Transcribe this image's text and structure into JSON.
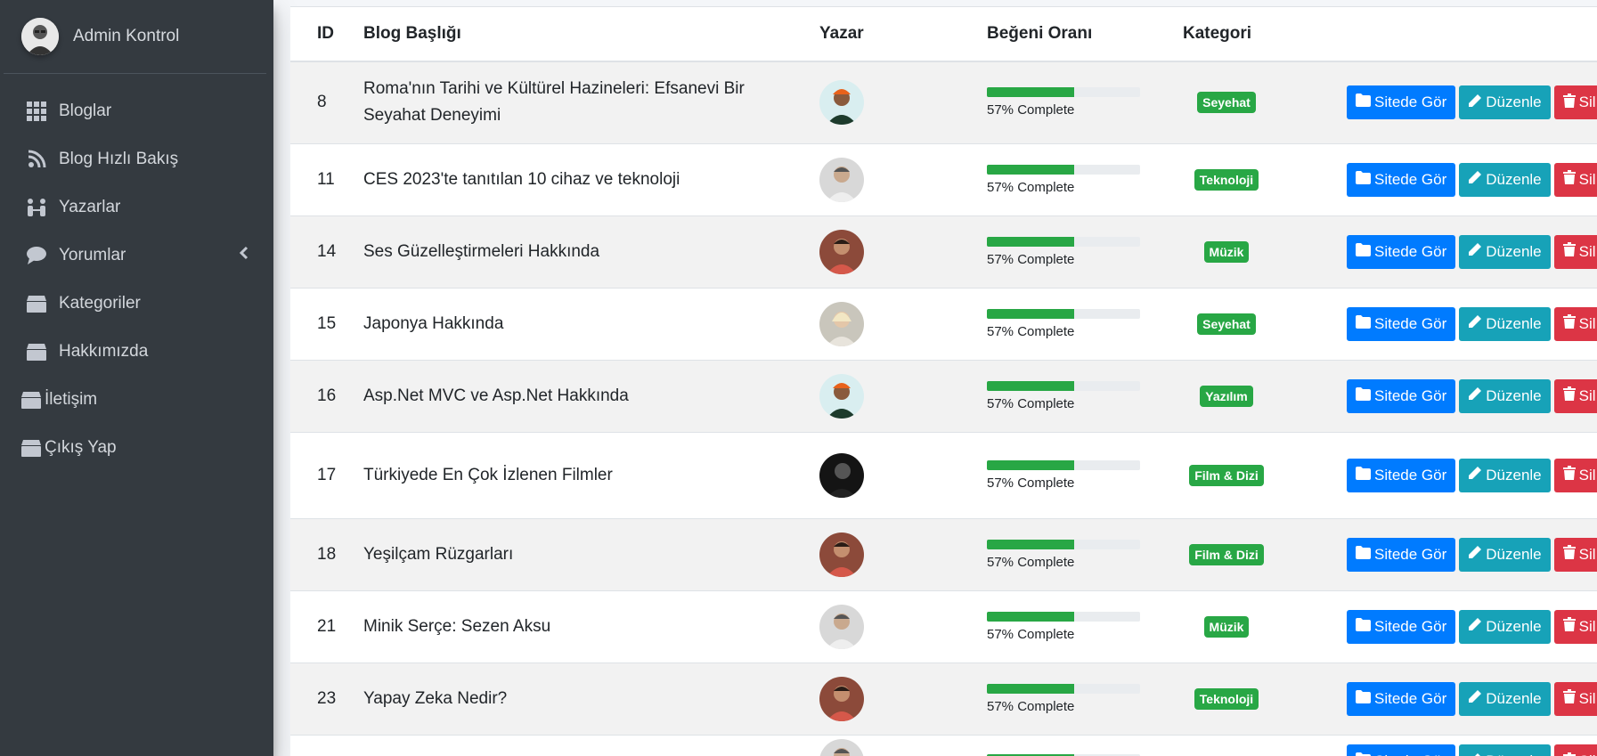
{
  "sidebar": {
    "brand_name": "Admin Kontrol",
    "items": [
      {
        "label": "Bloglar",
        "icon": "grid-icon"
      },
      {
        "label": "Blog Hızlı Bakış",
        "icon": "rss-icon"
      },
      {
        "label": "Yazarlar",
        "icon": "users-icon"
      },
      {
        "label": "Yorumlar",
        "icon": "comment-icon"
      },
      {
        "label": "Kategoriler",
        "icon": "box-icon"
      },
      {
        "label": "Hakkımızda",
        "icon": "box-icon"
      },
      {
        "label": "İletişim",
        "icon": "box-icon"
      },
      {
        "label": "Çıkış Yap",
        "icon": "box-icon"
      }
    ]
  },
  "table": {
    "headers": {
      "id": "ID",
      "title": "Blog Başlığı",
      "author": "Yazar",
      "rating": "Beğeni Oranı",
      "category": "Kategori"
    },
    "actions": {
      "view": "Sitede Gör",
      "edit": "Düzenle",
      "delete": "Sil"
    },
    "rows": [
      {
        "id": "8",
        "title": "Roma'nın Tarihi ve Kültürel Hazineleri: Efsanevi Bir Seyahat Deneyimi",
        "progress": 57,
        "progress_text": "57% Complete",
        "category": "Seyehat",
        "author_style": "orange-hat"
      },
      {
        "id": "11",
        "title": "CES 2023'te tanıtılan 10 cihaz ve teknoloji",
        "progress": 57,
        "progress_text": "57% Complete",
        "category": "Teknoloji",
        "author_style": "grey-man"
      },
      {
        "id": "14",
        "title": "Ses Güzelleştirmeleri Hakkında",
        "progress": 57,
        "progress_text": "57% Complete",
        "category": "Müzik",
        "author_style": "red-man"
      },
      {
        "id": "15",
        "title": "Japonya Hakkında",
        "progress": 57,
        "progress_text": "57% Complete",
        "category": "Seyehat",
        "author_style": "blonde-woman"
      },
      {
        "id": "16",
        "title": "Asp.Net MVC ve Asp.Net Hakkında",
        "progress": 57,
        "progress_text": "57% Complete",
        "category": "Yazılım",
        "author_style": "orange-hat"
      },
      {
        "id": "17",
        "title": "Türkiyede En Çok İzlenen Filmler",
        "progress": 57,
        "progress_text": "57% Complete",
        "category": "Film & Dizi",
        "author_style": "dark-man"
      },
      {
        "id": "18",
        "title": "Yeşilçam Rüzgarları",
        "progress": 57,
        "progress_text": "57% Complete",
        "category": "Film & Dizi",
        "author_style": "red-man"
      },
      {
        "id": "21",
        "title": "Minik Serçe: Sezen Aksu",
        "progress": 57,
        "progress_text": "57% Complete",
        "category": "Müzik",
        "author_style": "grey-man"
      },
      {
        "id": "23",
        "title": "Yapay Zeka Nedir?",
        "progress": 57,
        "progress_text": "57% Complete",
        "category": "Teknoloji",
        "author_style": "red-man"
      },
      {
        "id": "",
        "title": "",
        "progress": 57,
        "progress_text": "",
        "category": "",
        "author_style": "grey-man"
      }
    ]
  },
  "colors": {
    "sidebar_bg": "#343a40",
    "primary": "#007bff",
    "info": "#17a2b8",
    "danger": "#dc3545",
    "success": "#28a745"
  }
}
